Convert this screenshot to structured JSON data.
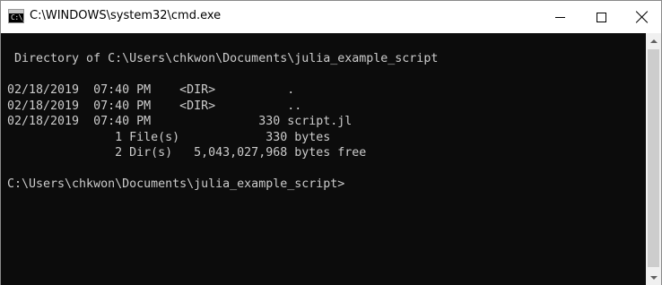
{
  "window": {
    "title": "C:\\WINDOWS\\system32\\cmd.exe",
    "icon_label": "C:\\_"
  },
  "controls": {
    "minimize": "minimize-icon",
    "maximize": "maximize-icon",
    "close": "close-icon"
  },
  "console": {
    "lines": [
      " Directory of C:\\Users\\chkwon\\Documents\\julia_example_script",
      "",
      "02/18/2019  07:40 PM    <DIR>          .",
      "02/18/2019  07:40 PM    <DIR>          ..",
      "02/18/2019  07:40 PM               330 script.jl",
      "               1 File(s)            330 bytes",
      "               2 Dir(s)   5,043,027,968 bytes free",
      "",
      "C:\\Users\\chkwon\\Documents\\julia_example_script>"
    ]
  },
  "colors": {
    "console_bg": "#0c0c0c",
    "console_fg": "#cccccc",
    "titlebar_bg": "#ffffff",
    "scrollbar_bg": "#f0f0f0",
    "scrollbar_thumb": "#cdcdcd"
  }
}
